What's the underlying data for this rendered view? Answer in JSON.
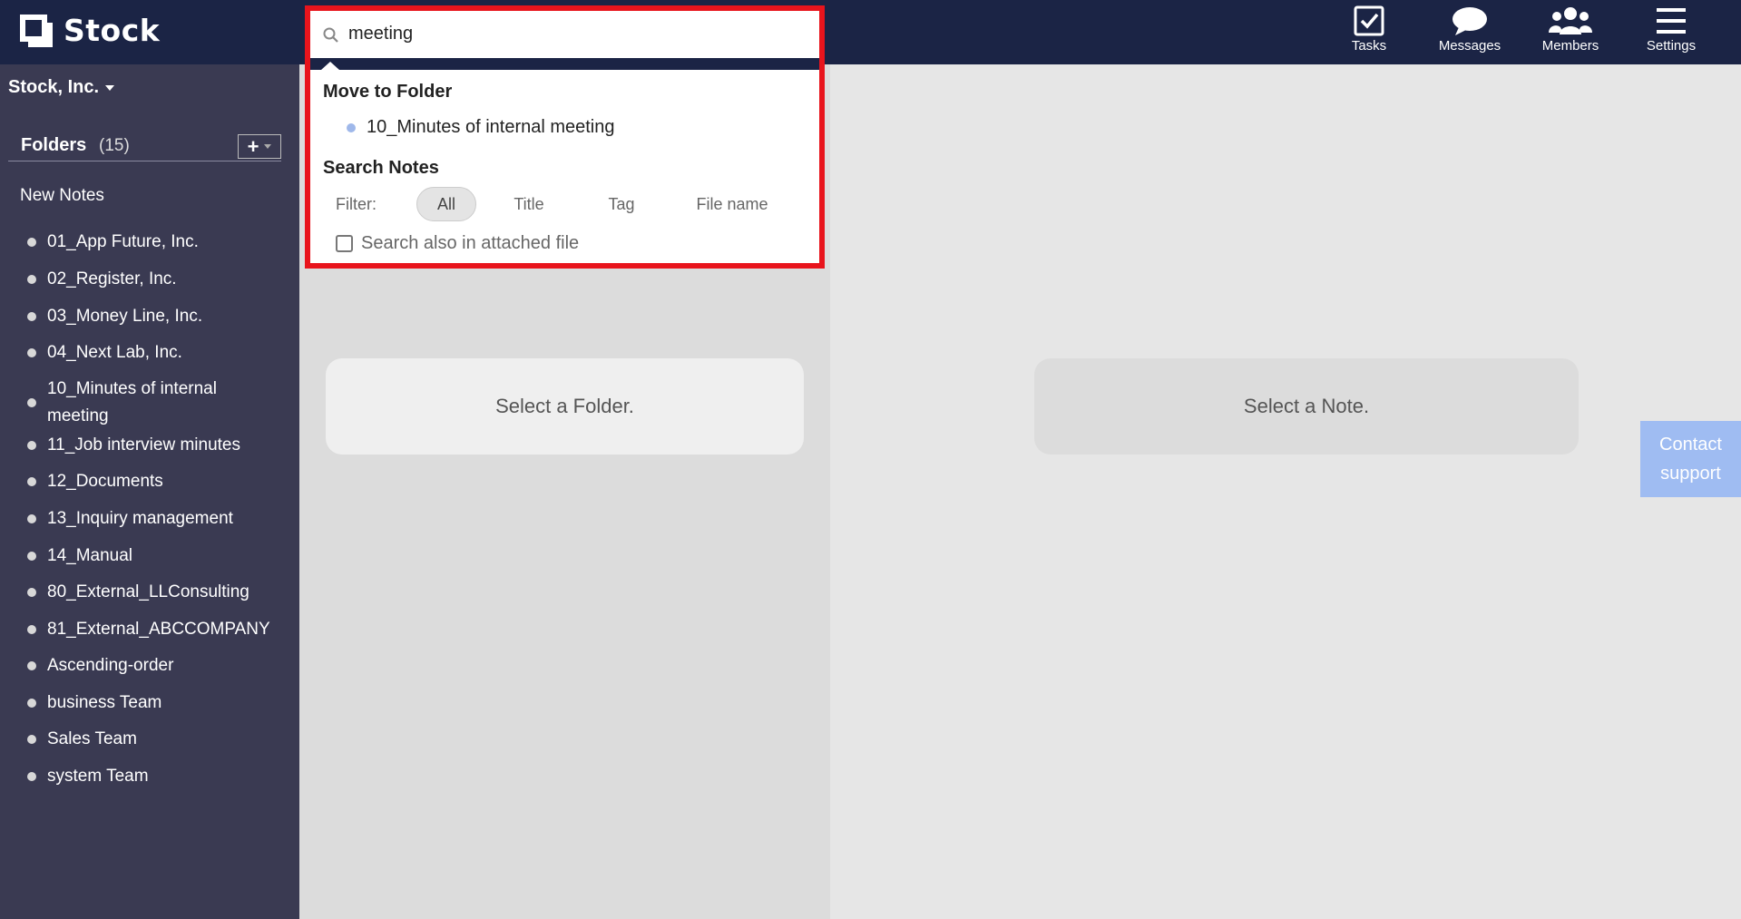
{
  "app": {
    "name": "Stock"
  },
  "header": {
    "nav": [
      {
        "label": "Tasks",
        "icon": "tasks-icon"
      },
      {
        "label": "Messages",
        "icon": "messages-icon"
      },
      {
        "label": "Members",
        "icon": "members-icon"
      },
      {
        "label": "Settings",
        "icon": "settings-icon"
      }
    ]
  },
  "sidebar": {
    "company": "Stock, Inc.",
    "folders_title": "Folders",
    "folders_count": "(15)",
    "new_notes": "New Notes",
    "folders": [
      "01_App Future, Inc.",
      "02_Register, Inc.",
      "03_Money Line, Inc.",
      "04_Next Lab, Inc.",
      "10_Minutes of internal meeting",
      "11_Job interview minutes",
      "12_Documents",
      "13_Inquiry management",
      "14_Manual",
      "80_External_LLConsulting",
      "81_External_ABCCOMPANY",
      "Ascending-order",
      "business Team",
      "Sales Team",
      "system Team"
    ]
  },
  "search": {
    "value": "meeting",
    "move_to_folder_title": "Move to Folder",
    "folder_result": "10_Minutes of internal meeting",
    "search_notes_title": "Search Notes",
    "filter_label": "Filter:",
    "filters": [
      "All",
      "Title",
      "Tag",
      "File name"
    ],
    "active_filter": "All",
    "attached_file_label": "Search also in attached file"
  },
  "main": {
    "folder_placeholder": "Select a Folder.",
    "note_placeholder": "Select a Note."
  },
  "contact_support": "Contact support",
  "colors": {
    "header_bg": "#1b2445",
    "sidebar_bg": "#3a3a52",
    "highlight_border": "#e8141c",
    "contact_bg": "#9fbcf2"
  }
}
